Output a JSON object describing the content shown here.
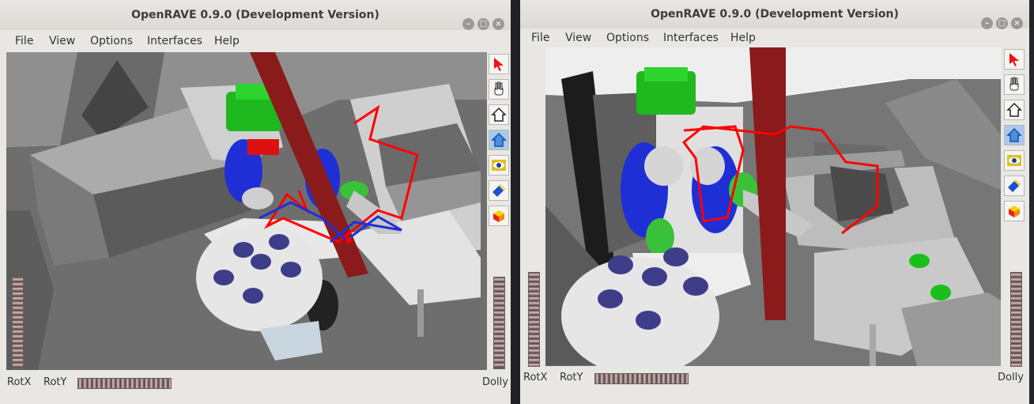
{
  "windows": [
    {
      "title": "OpenRAVE 0.9.0 (Development Version)",
      "menu": [
        "File",
        "View",
        "Options",
        "Interfaces",
        "Help"
      ],
      "tools": [
        "select-arrow-icon",
        "hand-icon",
        "home-icon",
        "home-view-icon",
        "eye-camera-icon",
        "flashlight-icon",
        "shading-cube-icon"
      ],
      "labels": {
        "rotx": "RotX",
        "roty": "RotY",
        "dolly": "Dolly"
      }
    },
    {
      "title": "OpenRAVE 0.9.0 (Development Version)",
      "menu": [
        "File",
        "View",
        "Options",
        "Interfaces",
        "Help"
      ],
      "tools": [
        "select-arrow-icon",
        "hand-icon",
        "home-icon",
        "home-view-icon",
        "eye-camera-icon",
        "flashlight-icon",
        "shading-cube-icon"
      ],
      "labels": {
        "rotx": "RotX",
        "roty": "RotY",
        "dolly": "Dolly"
      }
    }
  ],
  "colors": {
    "window_bg": "#e9e7e3",
    "scene_gray": "#808080",
    "robot_green": "#19c019",
    "robot_blue": "#1f2fd6",
    "pillar_red": "#8b1a1a",
    "trajectory_red": "#ff0000"
  }
}
